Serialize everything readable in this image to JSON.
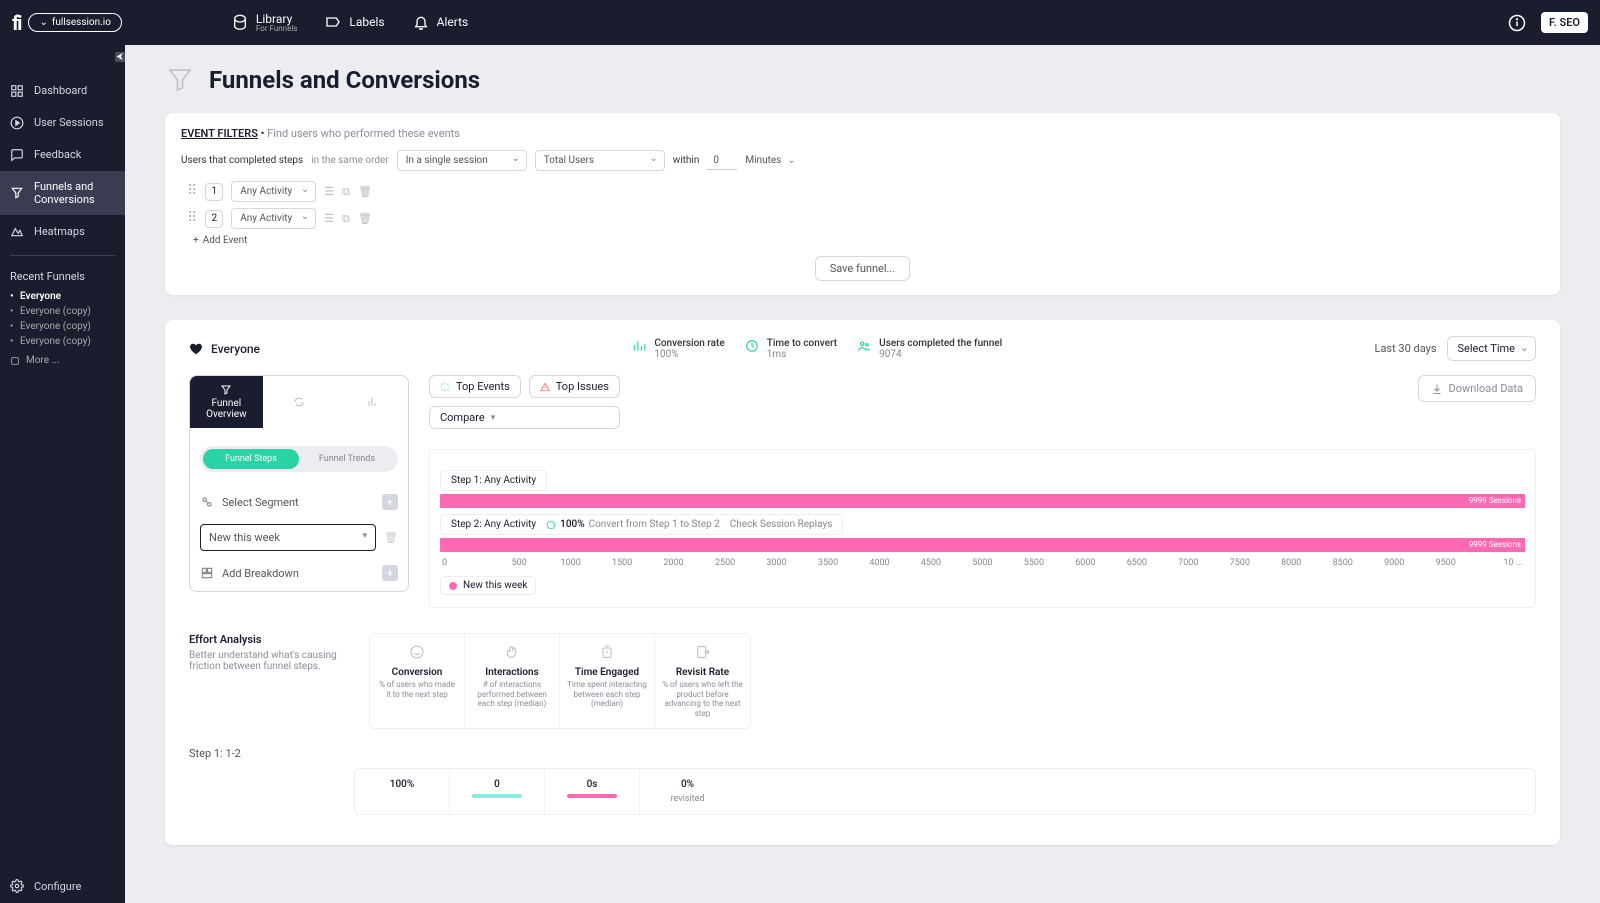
{
  "topbar": {
    "site": "fullsession.io",
    "nav": {
      "library": "Library",
      "library_sub": "For Funnels",
      "labels": "Labels",
      "alerts": "Alerts"
    },
    "user_badge": "F. SEO"
  },
  "sidebar": {
    "items": {
      "dashboard": "Dashboard",
      "sessions": "User Sessions",
      "feedback": "Feedback",
      "funnels": "Funnels and Conversions",
      "heatmaps": "Heatmaps"
    },
    "recent_heading": "Recent Funnels",
    "recent": [
      "Everyone",
      "Everyone (copy)",
      "Everyone (copy)",
      "Everyone (copy)"
    ],
    "more": "More ...",
    "configure": "Configure"
  },
  "page": {
    "title": "Funnels and Conversions"
  },
  "filters": {
    "ef_label": "EVENT FILTERS",
    "ef_desc": "Find users who performed these events",
    "line2_a": "Users that completed steps",
    "line2_b": "in the same order",
    "session_sel": "In a single session",
    "users_sel": "Total Users",
    "within": "within",
    "within_val": "0",
    "minutes": "Minutes",
    "step1_activity": "Any Activity",
    "step2_activity": "Any Activity",
    "add_event": "Add Event",
    "save": "Save funnel..."
  },
  "report": {
    "everyone": "Everyone",
    "metrics": {
      "conv_lbl": "Conversion rate",
      "conv_val": "100%",
      "time_lbl": "Time to convert",
      "time_val": "1ms",
      "users_lbl": "Users completed the funnel",
      "users_val": "9074"
    },
    "last30": "Last 30 days",
    "select_time": "Select Time",
    "tabs": {
      "overview": "Funnel Overview"
    },
    "subtabs": {
      "steps": "Funnel Steps",
      "trends": "Funnel Trends"
    },
    "panel": {
      "select_segment": "Select Segment",
      "segment_value": "New this week",
      "add_breakdown": "Add Breakdown"
    },
    "chips": {
      "top_events": "Top Events",
      "top_issues": "Top Issues",
      "compare": "Compare",
      "download": "Download Data"
    },
    "chart": {
      "step1_label": "Step 1: Any Activity",
      "step2_label": "Step 2: Any Activity",
      "step2_conv": "100%",
      "step2_conv_txt": " Convert from Step 1 to Step 2",
      "step2_replays": "Check Session Replays",
      "bar_value": "9999 Sessions",
      "legend": "New this week"
    },
    "effort": {
      "title": "Effort Analysis",
      "desc": "Better understand what's causing friction between funnel steps.",
      "cols": {
        "conversion": "Conversion",
        "conversion_sub": "% of users who made it to the next step",
        "interactions": "Interactions",
        "interactions_sub": "# of interactions performed between each step (median)",
        "time": "Time Engaged",
        "time_sub": "Time spent interacting between each step (median)",
        "revisit": "Revisit Rate",
        "revisit_sub": "% of users who left the product before advancing to the next step"
      },
      "step_label": "Step 1: 1-2",
      "vals": {
        "conv": "100%",
        "inter": "0",
        "time": "0s",
        "revisit_a": "0%",
        "revisit_b": "revisited"
      }
    }
  },
  "chart_data": {
    "type": "bar",
    "orientation": "horizontal",
    "series": [
      {
        "name": "New this week",
        "color": "#ff69b4",
        "values": [
          9999,
          9999
        ]
      }
    ],
    "categories": [
      "Step 1: Any Activity",
      "Step 2: Any Activity"
    ],
    "xlabel": "",
    "ylabel": "",
    "xlim": [
      0,
      10000
    ],
    "x_ticks": [
      0,
      500,
      1000,
      1500,
      2000,
      2500,
      3000,
      3500,
      4000,
      4500,
      5000,
      5500,
      6000,
      6500,
      7000,
      7500,
      8000,
      8500,
      9000,
      9500,
      "10 ..."
    ]
  }
}
